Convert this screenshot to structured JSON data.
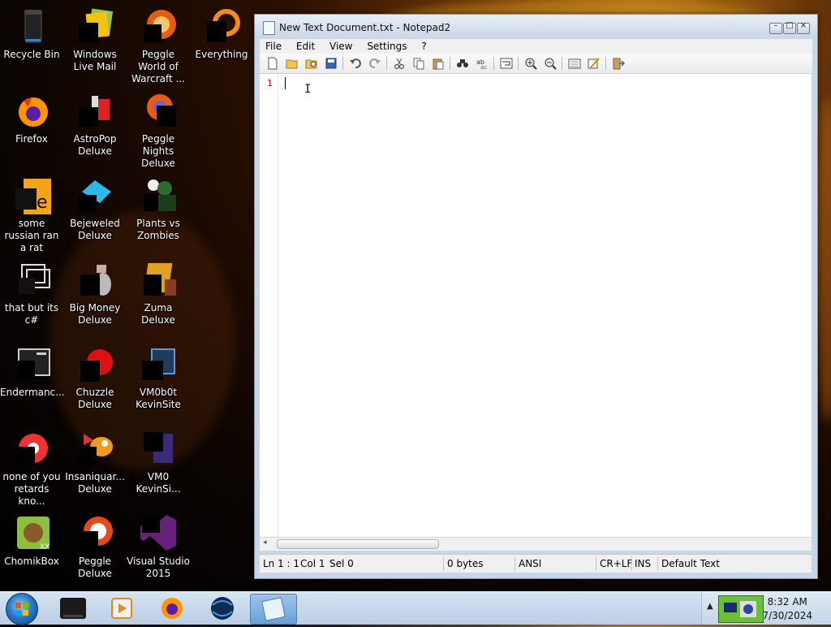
{
  "desktop": {
    "icons": [
      {
        "label": "Recycle Bin",
        "icon": "recycle-bin-icon"
      },
      {
        "label": "Windows Live Mail",
        "icon": "mail-icon"
      },
      {
        "label": "Peggle World of Warcraft ...",
        "icon": "peggle-icon"
      },
      {
        "label": "Everything",
        "icon": "everything-search-icon"
      },
      {
        "label": "Firefox",
        "icon": "firefox-icon"
      },
      {
        "label": "AstroPop Deluxe",
        "icon": "astropop-icon"
      },
      {
        "label": "Peggle Nights Deluxe",
        "icon": "peggle-nights-icon"
      },
      {
        "label": "some russian ran a rat",
        "icon": "java-file-icon"
      },
      {
        "label": "Bejeweled Deluxe",
        "icon": "bejeweled-icon"
      },
      {
        "label": "Plants vs Zombies",
        "icon": "plants-vs-zombies-icon"
      },
      {
        "label": "that but its c#",
        "icon": "shortcut-icon"
      },
      {
        "label": "Big Money Deluxe",
        "icon": "big-money-icon"
      },
      {
        "label": "Zuma Deluxe",
        "icon": "zuma-icon"
      },
      {
        "label": "Endermanc...",
        "icon": "application-window-icon"
      },
      {
        "label": "Chuzzle Deluxe",
        "icon": "chuzzle-icon"
      },
      {
        "label": "VM0b0t KevinSite",
        "icon": "vm-bot-icon"
      },
      {
        "label": "none of you retards kno...",
        "icon": "chrome-icon"
      },
      {
        "label": "Insaniquar... Deluxe",
        "icon": "insaniquarium-icon"
      },
      {
        "label": "VM0 KevinSi...",
        "icon": "vm-file-icon"
      },
      {
        "label": "ChomikBox",
        "icon": "chomikbox-icon"
      },
      {
        "label": "Peggle Deluxe",
        "icon": "peggle-deluxe-icon"
      },
      {
        "label": "Visual Studio 2015",
        "icon": "visual-studio-icon"
      }
    ]
  },
  "window": {
    "title": "New Text Document.txt - Notepad2",
    "menu": [
      "File",
      "Edit",
      "View",
      "Settings",
      "?"
    ],
    "line_number": "1",
    "status": {
      "ln": "Ln 1 : 1",
      "col": "Col 1",
      "sel": "Sel 0",
      "size": "0 bytes",
      "encoding": "ANSI",
      "eol": "CR+LF",
      "mode": "INS",
      "scheme": "Default Text"
    }
  },
  "taskbar": {
    "time": "8:32 AM",
    "date": "7/30/2024"
  },
  "colors": {
    "line_number": "#c00000",
    "taskbar": "#c6d8ec"
  }
}
